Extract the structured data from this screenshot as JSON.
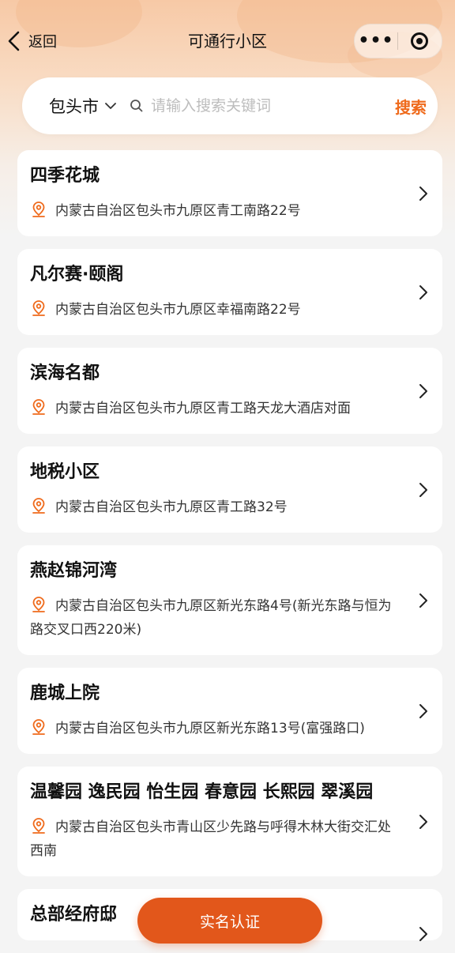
{
  "nav": {
    "back_label": "返回",
    "title": "可通行小区",
    "more_icon": "more-dots-icon",
    "close_icon": "target-close-icon"
  },
  "search": {
    "city": "包头市",
    "placeholder": "请输入搜索关键词",
    "value": "",
    "button_label": "搜索"
  },
  "colors": {
    "accent": "#ef6a1b",
    "button": "#e2571b"
  },
  "communities": [
    {
      "name": "四季花城",
      "address": "内蒙古自治区包头市九原区青工南路22号"
    },
    {
      "name": "凡尔赛·颐阁",
      "address": "内蒙古自治区包头市九原区幸福南路22号"
    },
    {
      "name": "滨海名都",
      "address": "内蒙古自治区包头市九原区青工路天龙大酒店对面"
    },
    {
      "name": "地税小区",
      "address": "内蒙古自治区包头市九原区青工路32号"
    },
    {
      "name": "燕赵锦河湾",
      "address": "内蒙古自治区包头市九原区新光东路4号(新光东路与恒为路交叉口西220米)"
    },
    {
      "name": "鹿城上院",
      "address": "内蒙古自治区包头市九原区新光东路13号(富强路口)"
    },
    {
      "name": "温馨园 逸民园 怡生园 春意园 长熙园 翠溪园",
      "address": "内蒙古自治区包头市青山区少先路与呼得木林大街交汇处西南"
    },
    {
      "name": "总部经府邸",
      "address": ""
    }
  ],
  "footer": {
    "button_label": "实名认证"
  }
}
